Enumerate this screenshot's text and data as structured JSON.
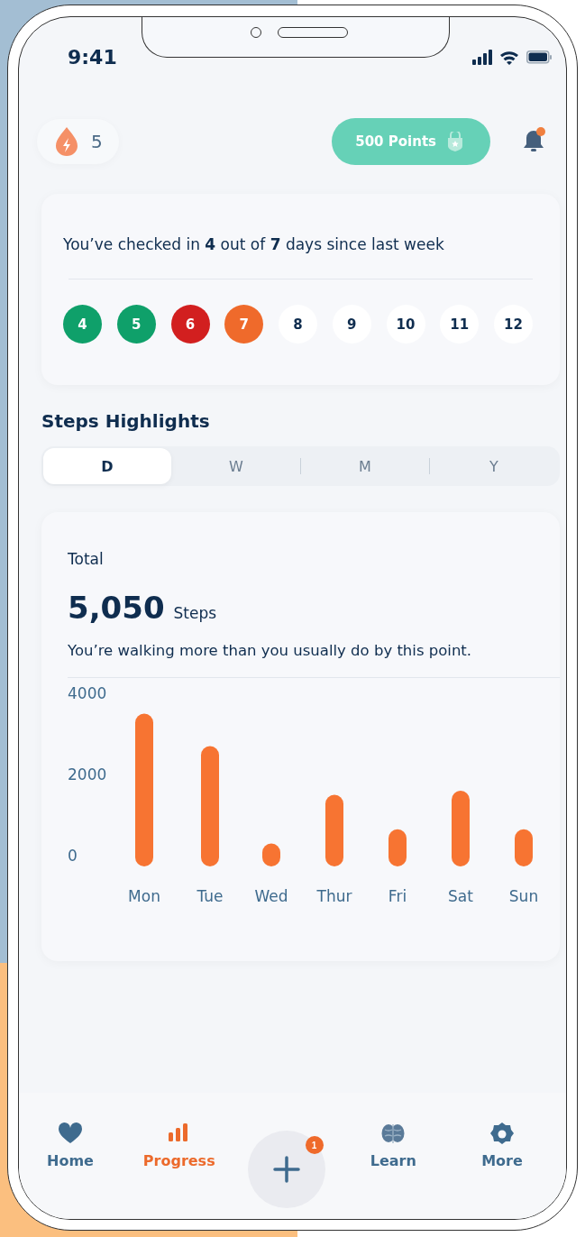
{
  "status_bar": {
    "time": "9:41"
  },
  "header": {
    "streak": "5",
    "points": "500 Points",
    "notification_dot": true
  },
  "checkin": {
    "message": "You’ve checked in **4** out of **7** days since last week",
    "days": [
      {
        "label": "4",
        "color": "#0fa06a"
      },
      {
        "label": "5",
        "color": "#0fa06a"
      },
      {
        "label": "6",
        "color": "#d21f1f"
      },
      {
        "label": "7",
        "color": "#ef6a2b"
      },
      {
        "label": "8",
        "color": "#ffffff"
      },
      {
        "label": "9",
        "color": "#ffffff"
      },
      {
        "label": "10",
        "color": "#ffffff"
      },
      {
        "label": "11",
        "color": "#ffffff"
      },
      {
        "label": "12",
        "color": "#ffffff"
      }
    ]
  },
  "steps_highlights": {
    "title": "Steps Highlights",
    "tabs": [
      {
        "label": "D",
        "selected": true
      },
      {
        "label": "W",
        "selected": false
      },
      {
        "label": "M",
        "selected": false
      },
      {
        "label": "Y",
        "selected": false
      }
    ],
    "card": {
      "label": "Total",
      "value": "5,050",
      "unit": "Steps",
      "message": "You’re walking more than you usually do by this point.",
      "chart_data": {
        "type": "bar",
        "categories": [
          "Mon",
          "Tue",
          "Wed",
          "Thur",
          "Fri",
          "Sat",
          "Sun"
        ],
        "series": [
          {
            "color": "#f77432",
            "values": [
              3500,
              2700,
              300,
              1500,
              650,
              1600,
              650
            ]
          }
        ],
        "ylim": [
          0,
          4000
        ],
        "yticks": [
          0,
          2000,
          4000
        ]
      }
    }
  },
  "bottom_nav": {
    "items": [
      {
        "kind": "tab",
        "label": "Home",
        "selected": false
      },
      {
        "kind": "tab",
        "label": "Progress",
        "selected": true
      },
      {
        "kind": "add",
        "badge": "1"
      },
      {
        "kind": "tab",
        "label": "Learn",
        "selected": false
      },
      {
        "kind": "tab",
        "label": "More",
        "selected": false
      }
    ]
  }
}
